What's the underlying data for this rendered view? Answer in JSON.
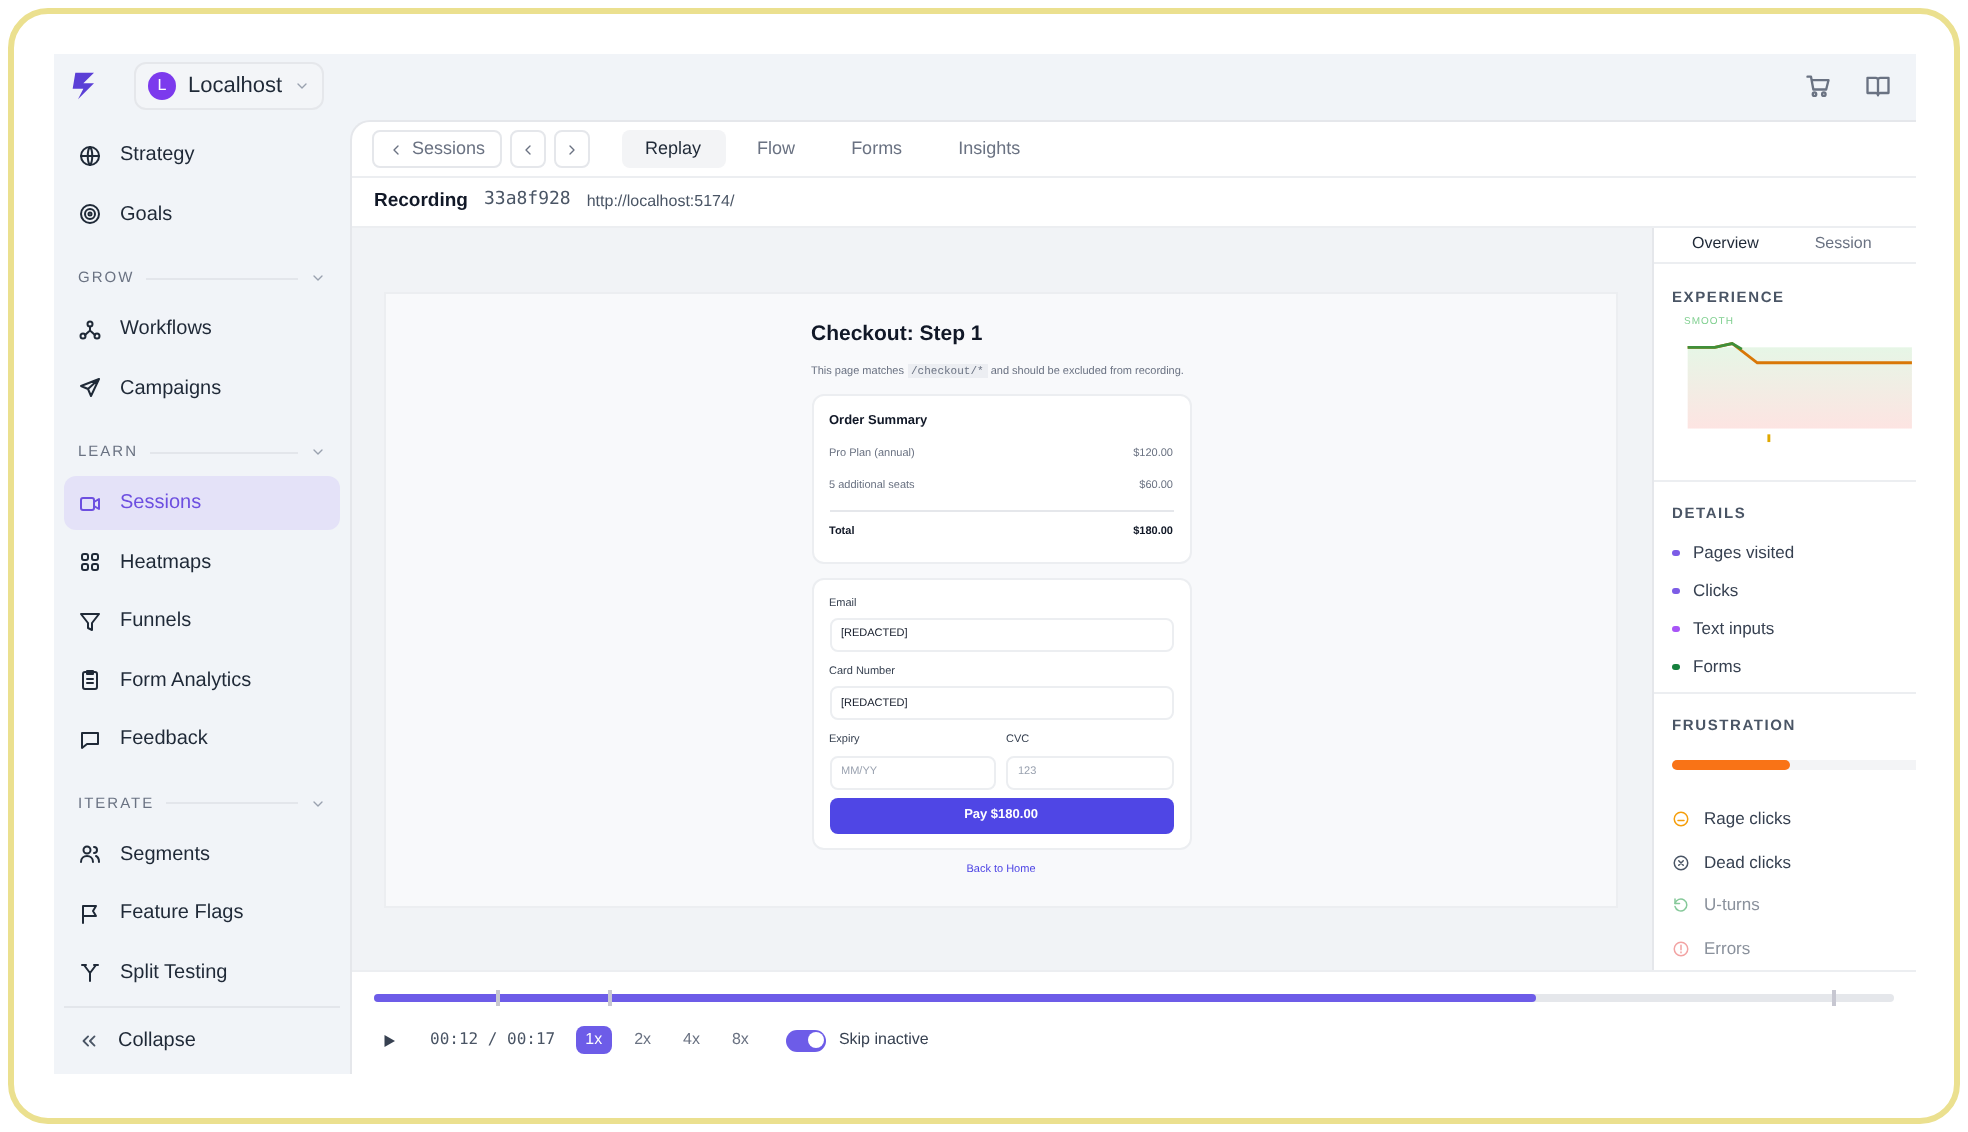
{
  "workspace": {
    "initial": "L",
    "name": "Localhost"
  },
  "sidebar": {
    "top_items": [
      {
        "label": "Strategy",
        "kind": "globe",
        "selected": false
      },
      {
        "label": "Goals",
        "kind": "target",
        "selected": false
      }
    ],
    "sections": [
      {
        "title": "GROW",
        "expanded": true,
        "items": [
          {
            "label": "Workflows",
            "kind": "nodes",
            "selected": false
          },
          {
            "label": "Campaigns",
            "kind": "send",
            "selected": false
          }
        ]
      },
      {
        "title": "LEARN",
        "expanded": true,
        "items": [
          {
            "label": "Sessions",
            "kind": "video",
            "selected": true
          },
          {
            "label": "Heatmaps",
            "kind": "grid",
            "selected": false
          },
          {
            "label": "Funnels",
            "kind": "funnel",
            "selected": false
          },
          {
            "label": "Form Analytics",
            "kind": "clipboard",
            "selected": false
          },
          {
            "label": "Feedback",
            "kind": "chat",
            "selected": false
          }
        ]
      },
      {
        "title": "ITERATE",
        "expanded": true,
        "items": [
          {
            "label": "Segments",
            "kind": "users",
            "selected": false
          },
          {
            "label": "Feature Flags",
            "kind": "flag",
            "selected": false
          },
          {
            "label": "Split Testing",
            "kind": "split",
            "selected": false
          }
        ]
      }
    ],
    "collapse": "Collapse"
  },
  "toolbar": {
    "back": "Sessions",
    "tabs": [
      {
        "label": "Replay",
        "selected": true
      },
      {
        "label": "Flow",
        "selected": false
      },
      {
        "label": "Forms",
        "selected": false
      },
      {
        "label": "Insights",
        "selected": false
      }
    ]
  },
  "recording": {
    "label": "Recording",
    "id": "33a8f928",
    "url": "http://localhost:5174/"
  },
  "replay": {
    "title": "Checkout: Step 1",
    "note_before": "This page matches",
    "note_code": "/checkout/*",
    "note_after": "and should be excluded from recording.",
    "summary": {
      "title": "Order Summary",
      "lines": [
        {
          "name": "Pro Plan (annual)",
          "amount": "$120.00"
        },
        {
          "name": "5 additional seats",
          "amount": "$60.00"
        }
      ],
      "total_label": "Total",
      "total": "$180.00"
    },
    "fields": [
      {
        "label": "Email",
        "value": "[REDACTED]"
      },
      {
        "label": "Card Number",
        "value": "[REDACTED]"
      }
    ],
    "half_fields": [
      {
        "label": "Expiry",
        "placeholder": "MM/YY"
      },
      {
        "label": "CVC",
        "placeholder": "123"
      }
    ],
    "pay": "Pay $180.00",
    "back_link": "Back to Home"
  },
  "panel": {
    "tabs": [
      {
        "label": "Overview",
        "selected": true
      },
      {
        "label": "Session",
        "selected": false
      }
    ],
    "experience": {
      "title": "EXPERIENCE",
      "label": "SMOOTH"
    },
    "details": {
      "title": "DETAILS",
      "items": [
        {
          "label": "Pages visited",
          "color": "#7c5ce6"
        },
        {
          "label": "Clicks",
          "color": "#7c5ce6"
        },
        {
          "label": "Text inputs",
          "color": "#a855f7"
        },
        {
          "label": "Forms",
          "color": "#15803d"
        }
      ]
    },
    "frustration": {
      "title": "FRUSTRATION",
      "level": 0.42,
      "items": [
        {
          "label": "Rage clicks",
          "kind": "frown",
          "disabled": false
        },
        {
          "label": "Dead clicks",
          "kind": "xcircle",
          "disabled": false
        },
        {
          "label": "U-turns",
          "kind": "undo",
          "disabled": true
        },
        {
          "label": "Errors",
          "kind": "alert",
          "disabled": true
        }
      ]
    }
  },
  "player": {
    "level": 0.765,
    "time": "00:12 / 00:17",
    "speeds": [
      {
        "label": "1x",
        "selected": true
      },
      {
        "label": "2x",
        "selected": false
      },
      {
        "label": "4x",
        "selected": false
      },
      {
        "label": "8x",
        "selected": false
      }
    ],
    "skip": {
      "label": "Skip inactive",
      "on": true
    }
  }
}
